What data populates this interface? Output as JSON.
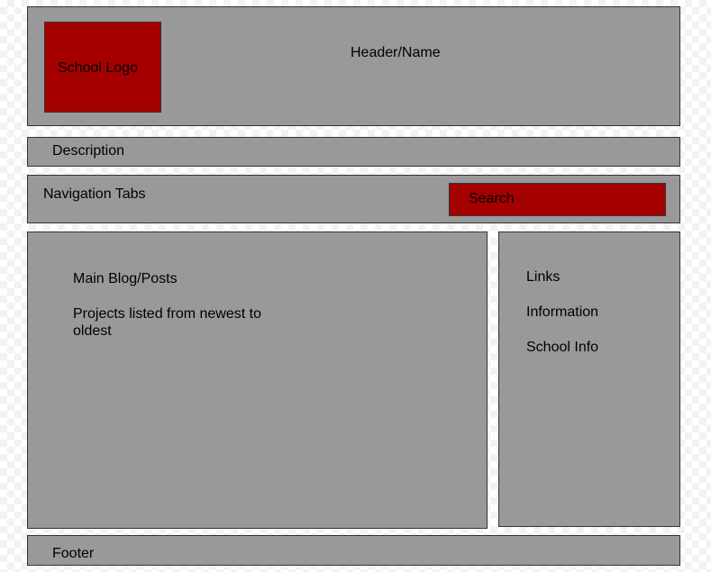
{
  "header": {
    "logo_label": "School Logo",
    "title": "Header/Name"
  },
  "description": {
    "label": "Description"
  },
  "navigation": {
    "label": "Navigation Tabs",
    "search_label": "Search"
  },
  "main": {
    "heading": "Main Blog/Posts",
    "body": "Projects listed from newest to oldest"
  },
  "sidebar": {
    "items": [
      {
        "label": "Links"
      },
      {
        "label": "Information"
      },
      {
        "label": "School Info"
      }
    ]
  },
  "footer": {
    "label": "Footer"
  },
  "colors": {
    "panel": "#999999",
    "accent": "#a50000",
    "border": "#333333"
  }
}
